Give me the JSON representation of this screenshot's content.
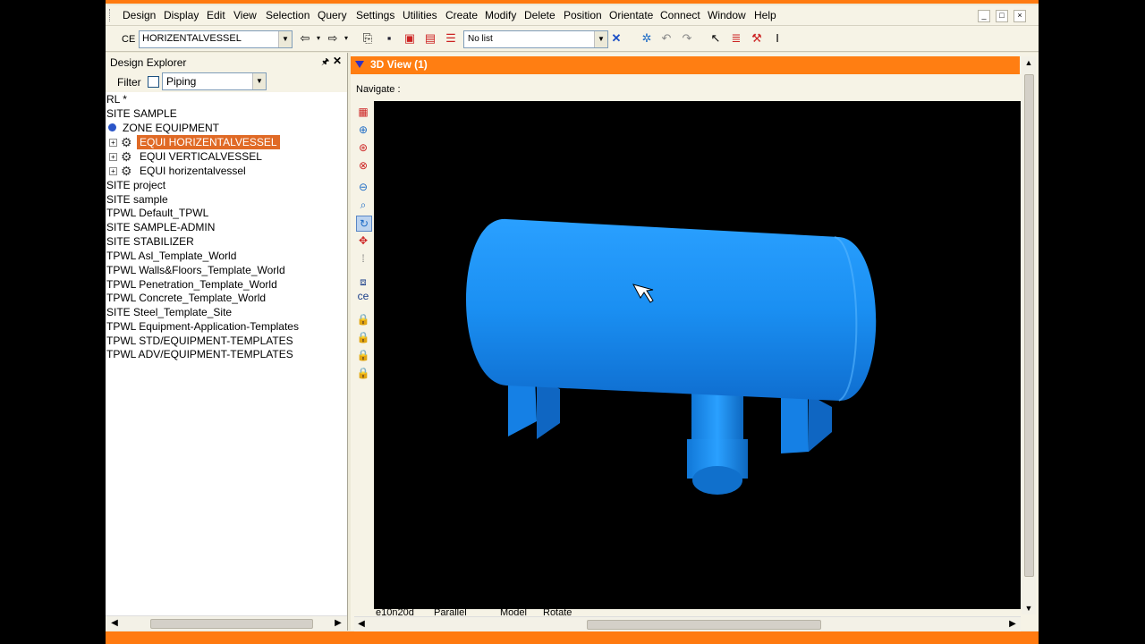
{
  "menu": {
    "items": [
      "Design",
      "Display",
      "Edit",
      "View",
      "Selection",
      "Query",
      "Settings",
      "Utilities",
      "Create",
      "Modify",
      "Delete",
      "Position",
      "Orientate",
      "Connect",
      "Window",
      "Help"
    ]
  },
  "toolbar": {
    "ce_label": "CE",
    "ce_value": "HORIZENTALVESSEL",
    "list_value": "No list"
  },
  "explorer": {
    "title": "Design Explorer",
    "filter_label": "Filter",
    "filter_value": "Piping",
    "tree": [
      "RL *",
      "SITE SAMPLE",
      "ZONE EQUIPMENT",
      "EQUI HORIZENTALVESSEL",
      "EQUI VERTICALVESSEL",
      "EQUI horizentalvessel",
      "SITE project",
      "SITE sample",
      "TPWL Default_TPWL",
      "SITE SAMPLE-ADMIN",
      "SITE STABILIZER",
      "TPWL Asl_Template_World",
      "TPWL Walls&Floors_Template_World",
      "TPWL Penetration_Template_World",
      "TPWL Concrete_Template_World",
      "SITE Steel_Template_Site",
      "TPWL Equipment-Application-Templates",
      "TPWL STD/EQUIPMENT-TEMPLATES",
      "TPWL ADV/EQUIPMENT-TEMPLATES"
    ]
  },
  "view": {
    "title": "3D View (1)",
    "navigate": "Navigate :",
    "status": {
      "direction": "e10n20d",
      "projection": "Parallel",
      "mode": "Model",
      "action": "Rotate"
    }
  },
  "colors": {
    "accent": "#ff7e12",
    "vessel": "#1e90f0",
    "selected": "#e06a26"
  }
}
